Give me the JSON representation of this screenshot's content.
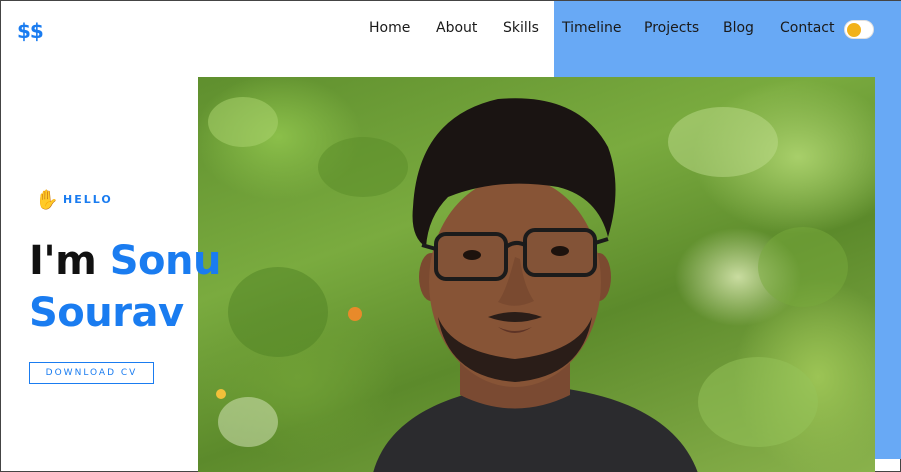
{
  "logo": "$$",
  "nav": {
    "items": [
      "Home",
      "About",
      "Skills",
      "Timeline",
      "Projects",
      "Blog",
      "Contact"
    ]
  },
  "theme_toggle": {
    "icon": "sun-toggle",
    "knob_color": "#f2b21a"
  },
  "hero": {
    "hello_icon": "waving-hand",
    "hello": "HELLO",
    "greeting": "I'm",
    "first_name": "Sonu",
    "last_name": "Sourav",
    "cv_button": "DOWNLOAD CV"
  },
  "photo": {
    "subject": "profile-photo"
  },
  "colors": {
    "accent": "#1a7cf0",
    "panel": "#68a9f5",
    "text": "#111111"
  }
}
